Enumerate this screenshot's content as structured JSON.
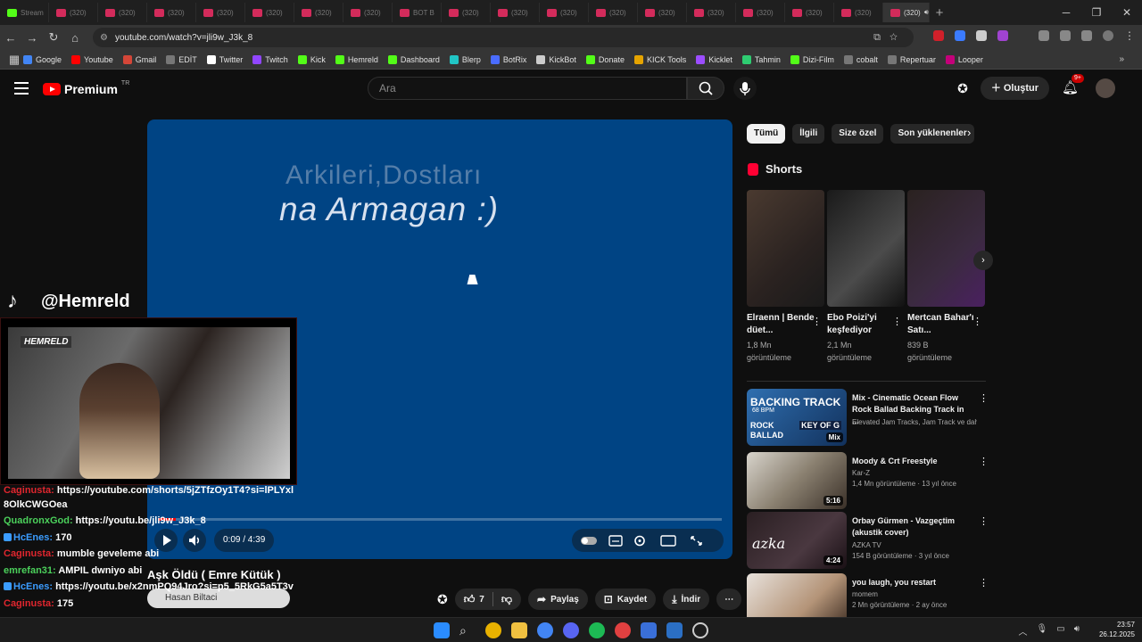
{
  "browser": {
    "tabs": [
      {
        "label": "Stream",
        "icon": "kick-favicon"
      },
      {
        "label": "(320)",
        "icon": "youtube-favicon"
      },
      {
        "label": "(320)",
        "icon": "youtube-favicon"
      },
      {
        "label": "(320)",
        "icon": "youtube-favicon"
      },
      {
        "label": "(320)",
        "icon": "youtube-favicon"
      },
      {
        "label": "(320)",
        "icon": "youtube-favicon"
      },
      {
        "label": "(320)",
        "icon": "youtube-favicon"
      },
      {
        "label": "(320)",
        "icon": "youtube-favicon"
      },
      {
        "label": "BOT B",
        "icon": "youtube-favicon"
      },
      {
        "label": "(320)",
        "icon": "youtube-favicon"
      },
      {
        "label": "(320)",
        "icon": "youtube-favicon"
      },
      {
        "label": "(320)",
        "icon": "youtube-favicon"
      },
      {
        "label": "(320)",
        "icon": "youtube-favicon"
      },
      {
        "label": "(320)",
        "icon": "youtube-favicon"
      },
      {
        "label": "(320)",
        "icon": "youtube-favicon"
      },
      {
        "label": "(320)",
        "icon": "youtube-favicon"
      },
      {
        "label": "(320)",
        "icon": "youtube-favicon"
      },
      {
        "label": "(320)",
        "icon": "youtube-favicon"
      },
      {
        "label": "(320)",
        "icon": "youtube-favicon"
      }
    ],
    "url": "youtube.com/watch?v=jli9w_J3k_8",
    "bookmarks": [
      "Google",
      "Youtube",
      "Gmail",
      "EDİT",
      "Twitter",
      "Twitch",
      "Kick",
      "Hemreld",
      "Dashboard",
      "Blerp",
      "BotRix",
      "KickBot",
      "Donate",
      "KICK Tools",
      "Kicklet",
      "Tahmin",
      "Dizi-Film",
      "cobalt",
      "Repertuar",
      "Looper"
    ]
  },
  "youtube": {
    "logo_text": "Premium",
    "region": "TR",
    "search_placeholder": "Ara",
    "create_label": "Oluştur",
    "notif_badge": "9+",
    "video": {
      "overlay_line1": "Arkileri,Dostları",
      "overlay_line2": "na Armagan :)",
      "time": "0:09 / 4:39",
      "progress": 0.032,
      "title": "Aşk Öldü ( Emre Kütük )",
      "channel": "Hasan Biltaci"
    },
    "actions": {
      "likes": "7",
      "share": "Paylaş",
      "save": "Kaydet",
      "download": "İndir"
    },
    "chips": [
      "Tümü",
      "İlgili",
      "Size özel",
      "Son yüklenenler"
    ],
    "shorts_title": "Shorts",
    "shorts": [
      {
        "title": "Elraenn | Bende düet...",
        "views": "1,8 Mn",
        "suffix": "görüntüleme"
      },
      {
        "title": "Ebo Poizi'yi keşfediyor",
        "views": "2,1 Mn",
        "suffix": "görüntüleme"
      },
      {
        "title": "Mertcan Bahar'ı Satı...",
        "views": "839 B",
        "suffix": "görüntüleme"
      }
    ],
    "related": [
      {
        "title": "Mix - Cinematic Ocean Flow Rock Ballad Backing Track in ...",
        "channel": "Elevated Jam Tracks, Jam Track ve daha...",
        "meta": "",
        "duration": "Mix",
        "thumb_text": [
          "BACKING TRACK",
          "68 BPM",
          "ROCK BALLAD",
          "KEY OF G"
        ]
      },
      {
        "title": "Moody & Crt Freestyle",
        "channel": "Kar-Z",
        "meta": "1,4 Mn görüntüleme · 13 yıl önce",
        "duration": "5:16"
      },
      {
        "title": "Orbay Gürmen - Vazgeçtim (akustik cover)",
        "channel": "AZKA TV",
        "meta": "154 B görüntüleme · 3 yıl önce",
        "duration": "4:24",
        "thumb_text": [
          "azka"
        ]
      },
      {
        "title": "you laugh, you restart",
        "channel": "momem",
        "meta": "2 Mn görüntüleme · 2 ay önce",
        "duration": ""
      }
    ]
  },
  "overlay": {
    "tiktok_handle": "@Hemreld",
    "cam_logo": "HEMRELD",
    "chat": [
      {
        "user": "Caginusta:",
        "color": "#e0262e",
        "text": "https://youtube.com/shorts/5jZTfzOy1T4?si=lPLYxl8OlkCWGOea"
      },
      {
        "user": "QuadronxGod:",
        "color": "#4bd05b",
        "text": "https://youtu.be/jli9w_J3k_8"
      },
      {
        "user": "HcEnes:",
        "color": "#3b9cff",
        "text": "170"
      },
      {
        "user": "Caginusta:",
        "color": "#e0262e",
        "text": "mumble geveleme abi"
      },
      {
        "user": "emrefan31:",
        "color": "#4bd05b",
        "text": "AMPIL dwniyo abi"
      },
      {
        "user": "HcEnes:",
        "color": "#3b9cff",
        "text": "https://youtu.be/x2nmPQ94Jro?si=p5_5RkG5a5T3v"
      },
      {
        "user": "Caginusta:",
        "color": "#e0262e",
        "text": "175"
      }
    ]
  },
  "taskbar": {
    "time": "23:57",
    "date": "26.12.2025"
  },
  "colors": {
    "accent": "#ff0000",
    "video_bg": "#004484",
    "page_bg": "#0f0f0f"
  }
}
